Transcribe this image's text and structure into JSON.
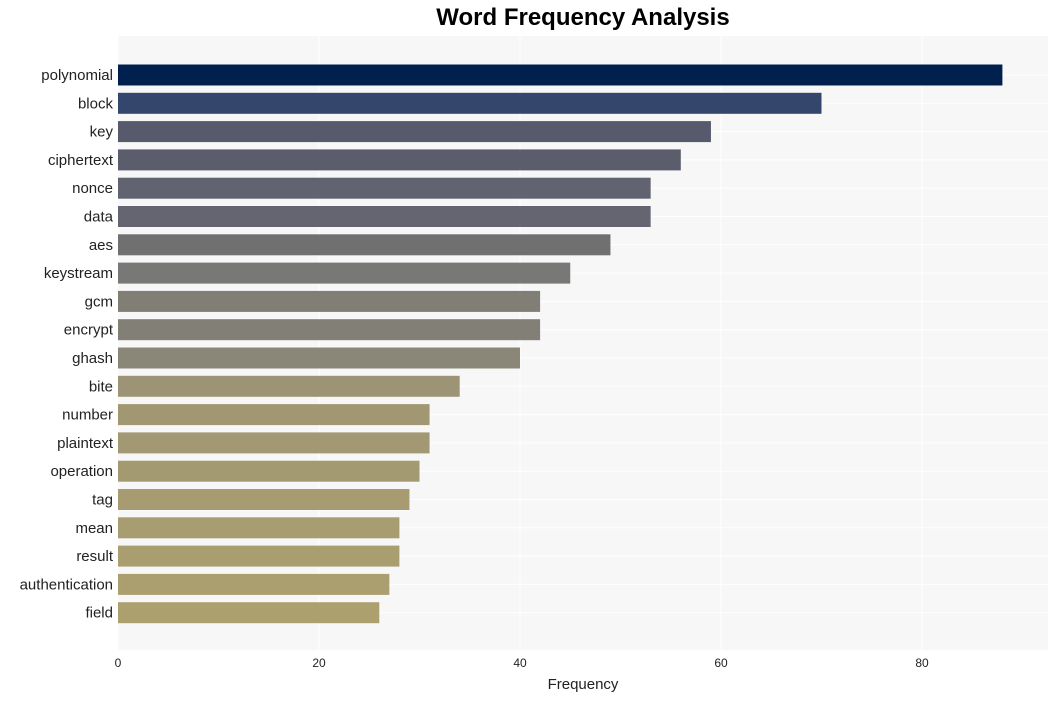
{
  "chart_data": {
    "type": "bar",
    "orientation": "horizontal",
    "title": "Word Frequency Analysis",
    "xlabel": "Frequency",
    "ylabel": "",
    "xlim": [
      0,
      92.5
    ],
    "xticks": [
      0,
      20,
      40,
      60,
      80
    ],
    "grid": true,
    "categories": [
      "polynomial",
      "block",
      "key",
      "ciphertext",
      "nonce",
      "data",
      "aes",
      "keystream",
      "gcm",
      "encrypt",
      "ghash",
      "bite",
      "number",
      "plaintext",
      "operation",
      "tag",
      "mean",
      "result",
      "authentication",
      "field"
    ],
    "values": [
      88,
      70,
      59,
      56,
      53,
      53,
      49,
      45,
      42,
      42,
      40,
      34,
      31,
      31,
      30,
      29,
      28,
      28,
      27,
      26
    ],
    "colors": [
      "#00204e",
      "#35466c",
      "#575a6c",
      "#5b5d6d",
      "#626370",
      "#646571",
      "#707070",
      "#787877",
      "#817e76",
      "#827f76",
      "#8a8778",
      "#9c9474",
      "#a19873",
      "#a29873",
      "#a49a72",
      "#a69b71",
      "#a89d70",
      "#a99e70",
      "#ab9f6f",
      "#ada06f"
    ],
    "plot_background": "#f7f7f7"
  }
}
